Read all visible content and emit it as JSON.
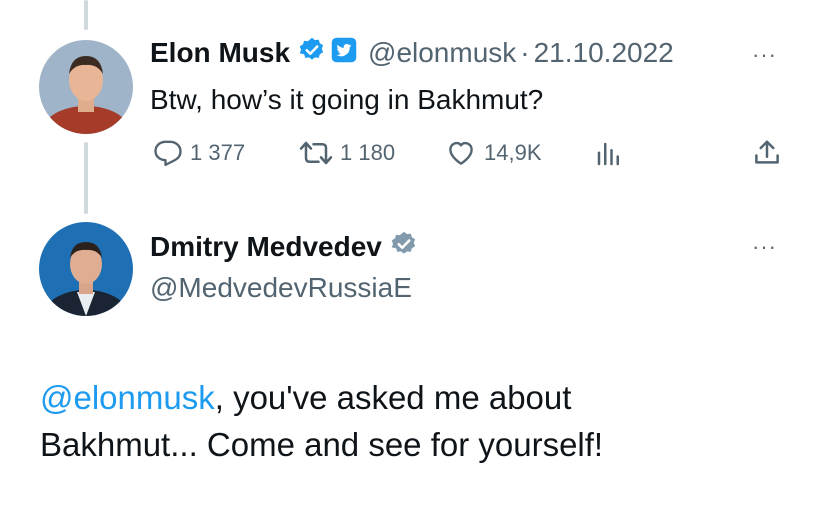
{
  "tweet1": {
    "name": "Elon Musk",
    "handle": "@elonmusk",
    "separator": "·",
    "date": "21.10.2022",
    "text": "Btw, how’s it going in Bakhmut?",
    "replies": "1 377",
    "retweets": "1 180",
    "likes": "14,9K",
    "avatar_icon": "avatar-photo",
    "verified_icon": "verified-badge-icon",
    "affiliate_icon": "twitter-bird-badge-icon"
  },
  "tweet2": {
    "name": "Dmitry Medvedev",
    "handle": "@MedvedevRussiaE",
    "mention": "@elonmusk",
    "text_line1_rest": ", you've asked me about",
    "text_line2": "Bakhmut... Come and see for yourself!",
    "verified_icon": "grey-verified-badge-icon"
  },
  "ui": {
    "more": "···"
  },
  "colors": {
    "text": "#0f1419",
    "muted": "#536471",
    "link": "#1d9bf0",
    "verified_blue": "#1d9bf0",
    "verified_grey": "#829aab",
    "thread_line": "#cfd9de"
  }
}
